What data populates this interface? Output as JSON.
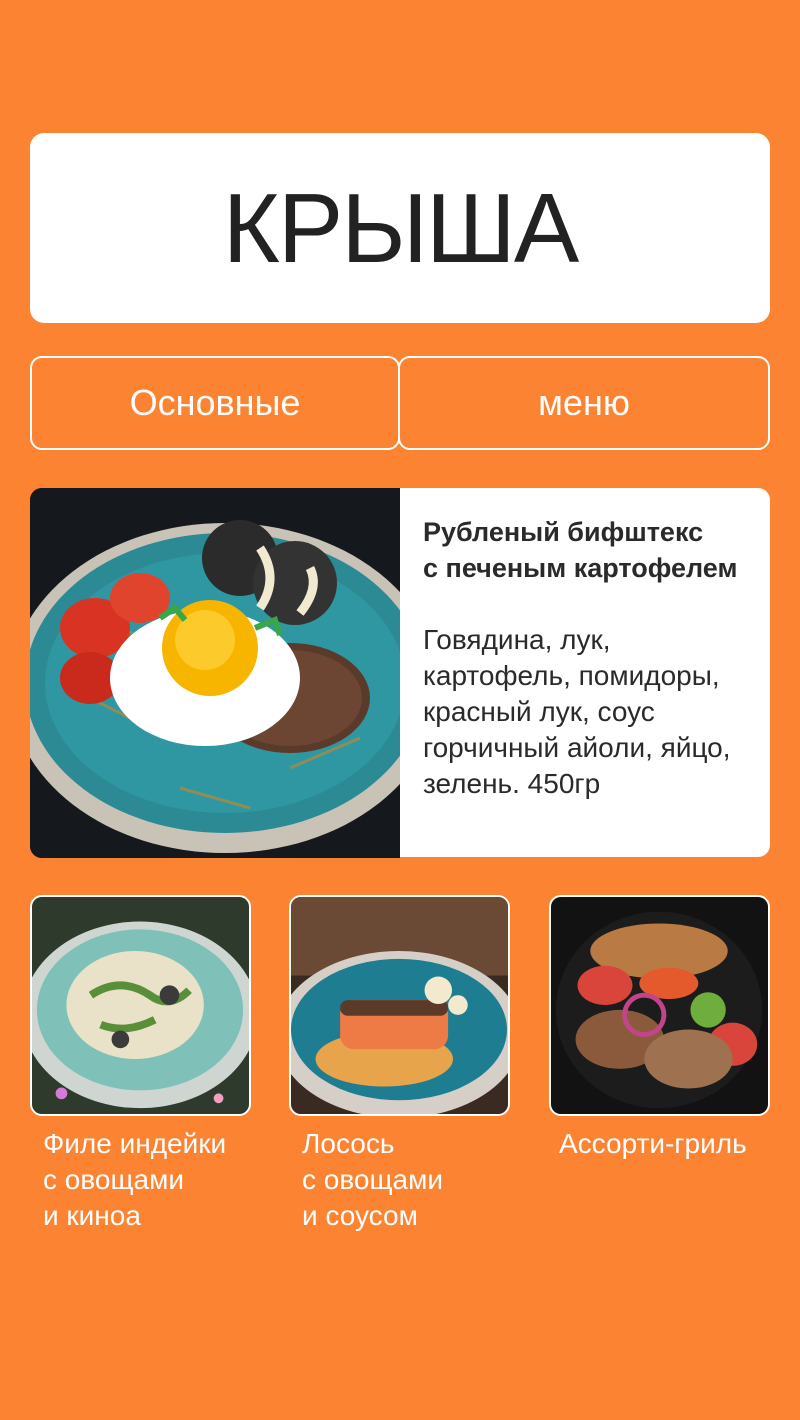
{
  "header": {
    "title": "КРЫША"
  },
  "tabs": [
    {
      "label": "Основные"
    },
    {
      "label": "меню"
    }
  ],
  "featured": {
    "name": "Рубленый бифштекс\nс печеным картофелем",
    "description": "Говядина, лук,\nкартофель, помидоры,\nкрасный лук, соус\nгорчичный айоли, яйцо,\nзелень. 450гр"
  },
  "dishes": [
    {
      "name": "Филе индейки\nс овощами\nи киноа"
    },
    {
      "name": "Лосось\nс овощами\nи  соусом"
    },
    {
      "name": "Ассорти-гриль"
    }
  ],
  "colors": {
    "background": "#fb8331",
    "card": "#ffffff",
    "text_dark": "#222222"
  }
}
